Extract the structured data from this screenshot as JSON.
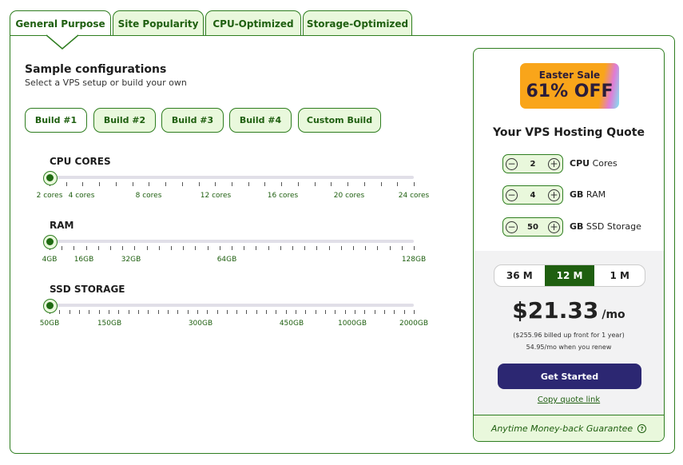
{
  "tabs": [
    {
      "label": "General Purpose",
      "active": true
    },
    {
      "label": "Site Popularity",
      "active": false
    },
    {
      "label": "CPU-Optimized",
      "active": false
    },
    {
      "label": "Storage-Optimized",
      "active": false
    }
  ],
  "configurator": {
    "title": "Sample configurations",
    "subtitle": "Select a VPS setup or build your own",
    "builds": [
      {
        "label": "Build #1",
        "active": true
      },
      {
        "label": "Build #2",
        "active": false
      },
      {
        "label": "Build #3",
        "active": false
      },
      {
        "label": "Build #4",
        "active": false
      },
      {
        "label": "Custom Build",
        "active": false
      }
    ],
    "sliders": {
      "cpu": {
        "label": "CPU CORES",
        "ticks": [
          "2 cores",
          "4 cores",
          "8 cores",
          "12 cores",
          "16 cores",
          "20 cores",
          "24 cores"
        ],
        "value": "2 cores"
      },
      "ram": {
        "label": "RAM",
        "ticks": [
          "4GB",
          "16GB",
          "32GB",
          "64GB",
          "128GB"
        ],
        "value": "4GB"
      },
      "storage": {
        "label": "SSD STORAGE",
        "ticks": [
          "50GB",
          "150GB",
          "300GB",
          "450GB",
          "1000GB",
          "2000GB"
        ],
        "value": "50GB"
      }
    }
  },
  "quote": {
    "sale_top": "Easter Sale",
    "sale_bottom": "61% OFF",
    "title": "Your VPS Hosting Quote",
    "steppers": {
      "cpu": {
        "value": "2",
        "unit": "CPU",
        "label": "Cores"
      },
      "ram": {
        "value": "4",
        "unit": "GB",
        "label": "RAM"
      },
      "storage": {
        "value": "50",
        "unit": "GB",
        "label": "SSD Storage"
      }
    },
    "terms": [
      {
        "label": "36 M",
        "active": false
      },
      {
        "label": "12 M",
        "active": true
      },
      {
        "label": "1 M",
        "active": false
      }
    ],
    "price": "$21.33",
    "price_unit": "/mo",
    "billed_note": "($255.96 billed up front for 1 year)",
    "renew_note": "54.95/mo when you renew",
    "cta_label": "Get Started",
    "copy_link": "Copy quote link",
    "guarantee": "Anytime Money-back Guarantee",
    "help_glyph": "?"
  },
  "colors": {
    "accent_green": "#2e7d1f",
    "light_green": "#e9f8dc",
    "cta_purple": "#2c2772",
    "sale_orange": "#f9a51a"
  }
}
